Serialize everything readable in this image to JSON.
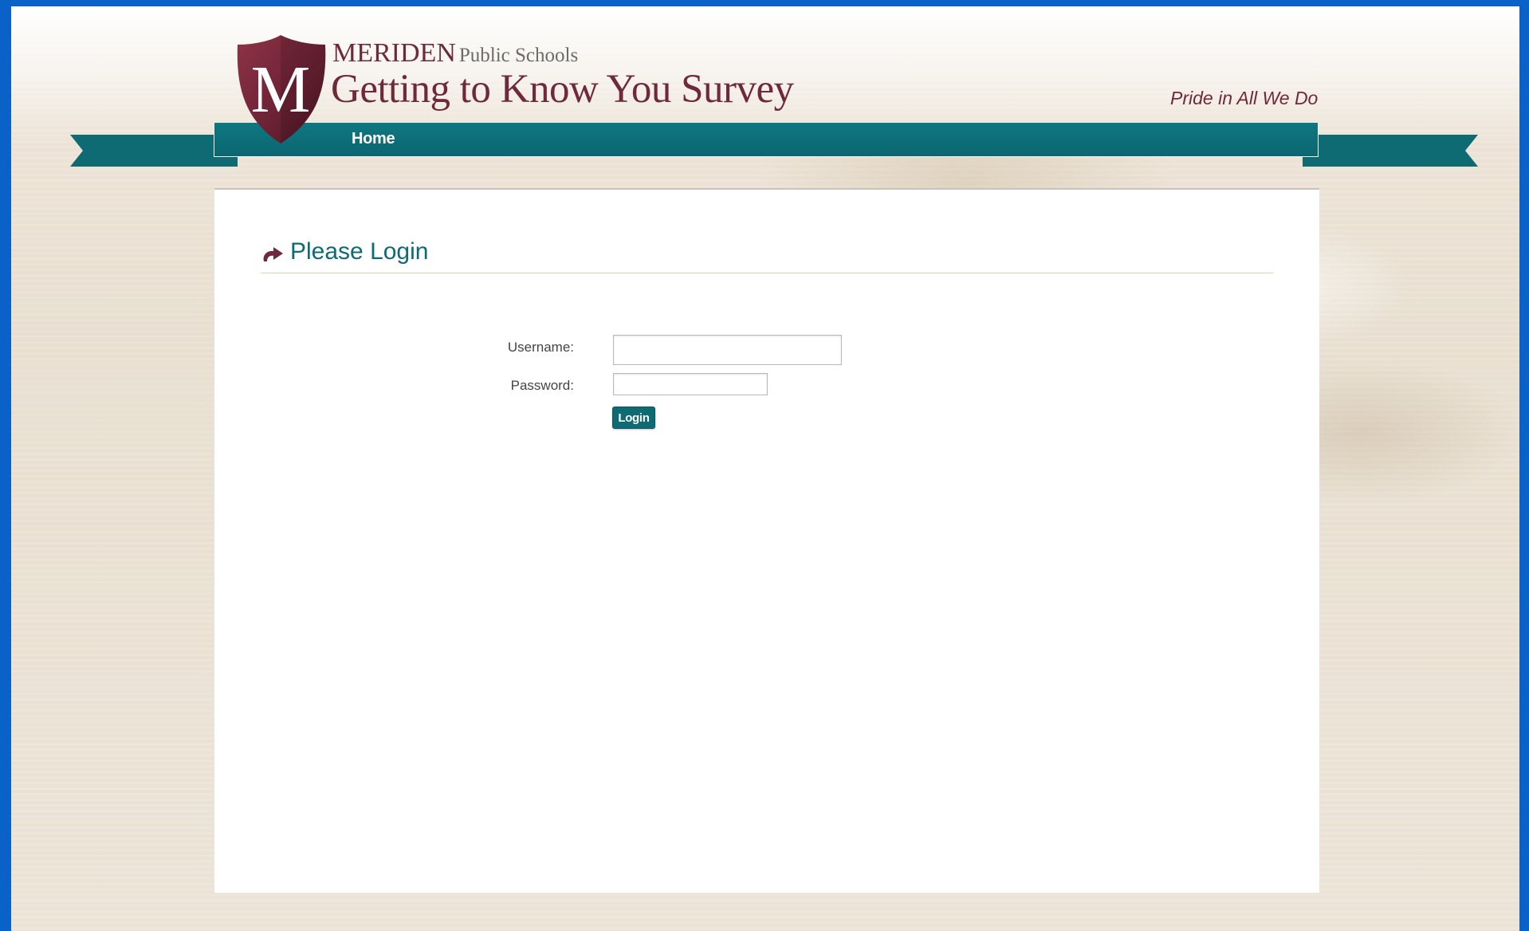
{
  "header": {
    "school_name": "MERIDEN",
    "school_suffix": "Public Schools",
    "survey_title": "Getting to Know You Survey",
    "tagline": "Pride in All We Do",
    "logo_letter": "M"
  },
  "nav": {
    "items": [
      {
        "label": "Home"
      }
    ]
  },
  "login": {
    "heading": "Please Login",
    "heading_icon": "return-arrow-icon",
    "username_label": "Username:",
    "username_value": "",
    "password_label": "Password:",
    "password_value": "",
    "submit_label": "Login"
  },
  "colors": {
    "brand_teal": "#0e6a73",
    "brand_maroon": "#6e2a3c",
    "page_border_blue": "#0a62c8"
  }
}
